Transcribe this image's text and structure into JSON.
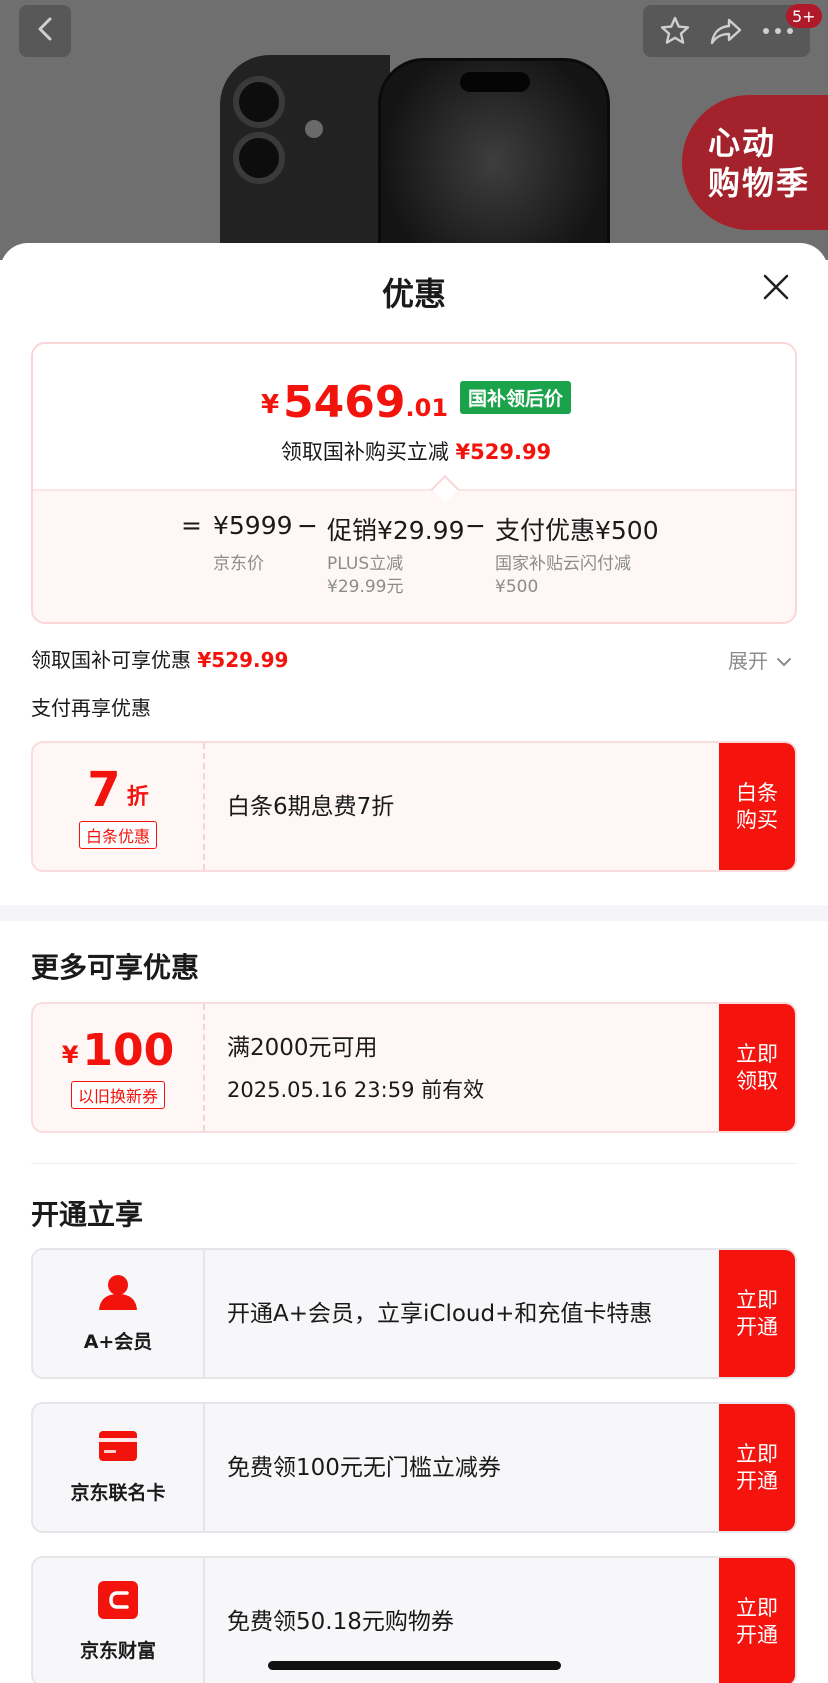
{
  "background": {
    "badge": "5+",
    "promo_stamp": [
      "心动",
      "购物季"
    ],
    "icons": [
      "back-icon",
      "star-icon",
      "share-icon",
      "more-icon"
    ]
  },
  "sheet": {
    "title": "优惠"
  },
  "price_card": {
    "yen": "¥",
    "price_main": "5469",
    "price_decimal": ".01",
    "badge": "国补领后价",
    "save_label": "领取国补购买立减",
    "save_amount": "¥529.99",
    "eq": "=",
    "jd_price": "¥5999",
    "minus1": "−",
    "promo": "促销¥29.99",
    "minus2": "−",
    "pay": "支付优惠¥500",
    "jd_price_label": "京东价",
    "promo_sub1": "PLUS立减",
    "promo_sub2": "¥29.99元",
    "pay_sub1": "国家补贴云闪付减",
    "pay_sub2": "¥500"
  },
  "gov_row": {
    "label": "领取国补可享优惠",
    "amount": "¥529.99",
    "expand": "展开"
  },
  "pay_section": {
    "title": "支付再享优惠",
    "coupon": {
      "discount_num": "7",
      "discount_unit": "折",
      "tag": "白条优惠",
      "main": "白条6期息费7折",
      "button_line1": "白条",
      "button_line2": "购买"
    }
  },
  "more_section": {
    "title": "更多可享优惠",
    "coupon": {
      "yen": "¥",
      "amount": "100",
      "tag": "以旧换新券",
      "main": "满2000元可用",
      "sub": "2025.05.16 23:59 前有效",
      "button_line1": "立即",
      "button_line2": "领取"
    }
  },
  "open_section": {
    "title": "开通立享",
    "items": [
      {
        "icon": "person-icon",
        "label": "A+会员",
        "main": "开通A+会员，立享iCloud+和充值卡特惠",
        "button_line1": "立即",
        "button_line2": "开通"
      },
      {
        "icon": "card-icon",
        "label": "京东联名卡",
        "main": "免费领100元无门槛立减券",
        "button_line1": "立即",
        "button_line2": "开通"
      },
      {
        "icon": "wallet-icon",
        "label": "京东财富",
        "main": "免费领50.18元购物券",
        "button_line1": "立即",
        "button_line2": "开通"
      }
    ]
  },
  "colors": {
    "accent_red": "#f2140c",
    "button_red": "#f5130e",
    "badge_green": "#1aa34a"
  }
}
